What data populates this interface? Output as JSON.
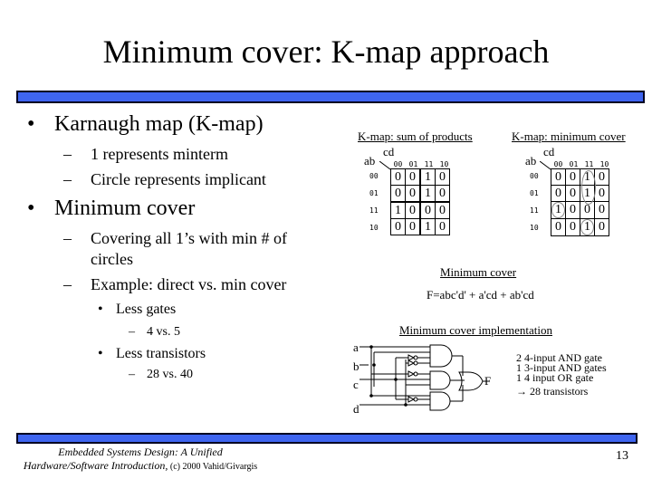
{
  "slide": {
    "title": "Minimum cover: K-map approach",
    "page_number": "13",
    "accent_color": "#3f65f0"
  },
  "bullets": {
    "b1": "Karnaugh map (K-map)",
    "b1_sub1": "1 represents minterm",
    "b1_sub2": "Circle represents implicant",
    "b2": "Minimum cover",
    "b2_sub1_line1": "Covering all 1’s with min # of",
    "b2_sub1_line2": "circles",
    "b2_sub2": "Example: direct vs. min cover",
    "b3": "Less gates",
    "b3_sub": "4 vs. 5",
    "b4": "Less transistors",
    "b4_sub": "28 vs. 40"
  },
  "kmap_sop": {
    "title": "K-map: sum of products",
    "row_var": "ab",
    "col_var": "cd",
    "col_labels": [
      "00",
      "01",
      "11",
      "10"
    ],
    "row_labels": [
      "00",
      "01",
      "11",
      "10"
    ],
    "rows": [
      [
        "0",
        "0",
        "1",
        "0"
      ],
      [
        "0",
        "0",
        "1",
        "0"
      ],
      [
        "1",
        "0",
        "0",
        "0"
      ],
      [
        "0",
        "0",
        "1",
        "0"
      ]
    ]
  },
  "kmap_min": {
    "title": "K-map: minimum cover",
    "row_var": "ab",
    "col_var": "cd",
    "col_labels": [
      "00",
      "01",
      "11",
      "10"
    ],
    "row_labels": [
      "00",
      "01",
      "11",
      "10"
    ],
    "rows": [
      [
        "0",
        "0",
        "1",
        "0"
      ],
      [
        "0",
        "0",
        "1",
        "0"
      ],
      [
        "1",
        "0",
        "0",
        "0"
      ],
      [
        "0",
        "0",
        "1",
        "0"
      ]
    ]
  },
  "min_cover": {
    "heading": "Minimum cover",
    "equation": "F=abc'd' + a'cd + ab'cd",
    "impl_heading": "Minimum cover implementation"
  },
  "circuit": {
    "inputs": [
      "a",
      "b",
      "c",
      "d"
    ],
    "output": "F"
  },
  "notes": {
    "line1": "2 4-input AND gate",
    "line2": "1 3-input AND gates",
    "line3": "1 4 input OR gate",
    "line4": "→ 28 transistors"
  },
  "footer": {
    "line1": "Embedded Systems Design: A Unified",
    "line2": "Hardware/Software Introduction,",
    "line2_suffix": " (c) 2000 Vahid/Givargis"
  }
}
